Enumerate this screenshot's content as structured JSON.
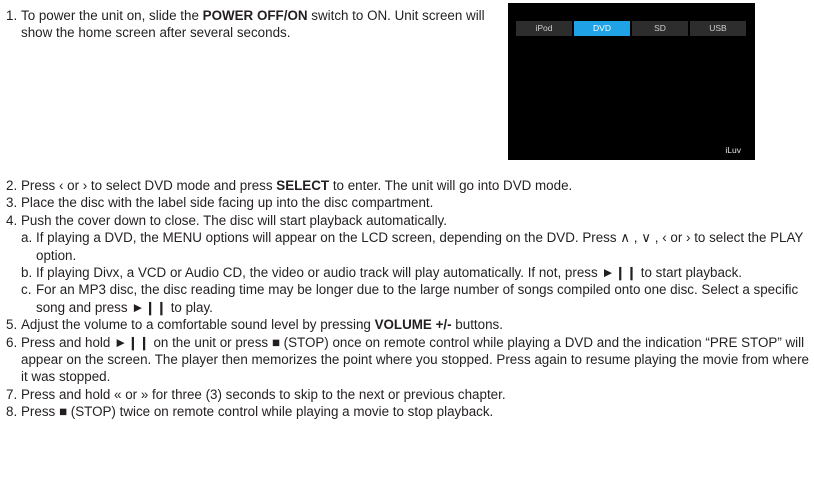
{
  "step1": {
    "number": "1.",
    "text_a": "To power the unit on, slide the ",
    "bold": "POWER OFF/ON",
    "text_b": " switch to ON. Unit screen will show the home screen after several seconds."
  },
  "screen": {
    "tabs": [
      "iPod",
      "DVD",
      "SD",
      "USB"
    ],
    "active_tab": "DVD",
    "brand": "iLuv",
    "colors": {
      "background": "#000000",
      "tab": "#2d2d2d",
      "active": "#1fa3e6"
    }
  },
  "steps": [
    {
      "n": "2.",
      "a": "Press ‹ or › to select DVD mode and press ",
      "b": "SELECT",
      "c": " to enter. The unit will go into DVD mode."
    },
    {
      "n": "3.",
      "a": "Place the disc with the label side facing up into the disc compartment.",
      "b": "",
      "c": ""
    },
    {
      "n": "4.",
      "a": "Push the cover down to close. The disc will start playback automatically.",
      "b": "",
      "c": ""
    },
    {
      "n": "a.",
      "sub": true,
      "a": "If playing a DVD, the MENU options will appear on the LCD screen, depending on the DVD. Press ∧ , ∨ , ‹ or › to select the PLAY option.",
      "b": "",
      "c": ""
    },
    {
      "n": "b.",
      "sub": true,
      "a": "If playing Divx, a VCD or Audio CD, the video or audio track will play automatically. If not, press ►❙❙ to start playback.",
      "b": "",
      "c": ""
    },
    {
      "n": "c.",
      "sub": true,
      "a": "For an MP3 disc, the disc reading time may be longer due to the large number of songs compiled onto one disc. Select a specific song and press ►❙❙ to play.",
      "b": "",
      "c": ""
    },
    {
      "n": "5.",
      "a": "Adjust the volume to a comfortable sound level by pressing ",
      "b": "VOLUME +/-",
      "c": " buttons."
    },
    {
      "n": "6.",
      "a": "Press and hold ►❙❙ on the unit or press ■ (STOP) once on remote control while playing a DVD and the indication “PRE STOP” will appear on the screen. The player then memorizes the point where you stopped. Press again to resume playing the movie from where it was stopped.",
      "b": "",
      "c": ""
    },
    {
      "n": "7.",
      "a": "Press and hold « or » for three (3) seconds to skip to the next or previous chapter.",
      "b": "",
      "c": ""
    },
    {
      "n": "8.",
      "a": "Press ■ (STOP) twice on remote control while playing a movie to stop playback.",
      "b": "",
      "c": ""
    }
  ]
}
